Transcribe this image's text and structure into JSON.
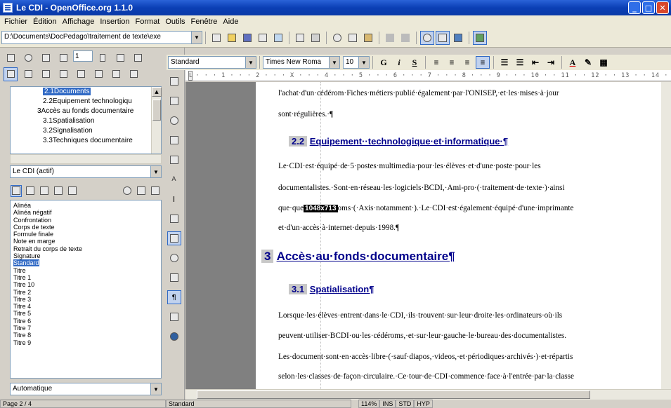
{
  "window": {
    "title": "Le CDI - OpenOffice.org 1.1.0"
  },
  "menu": [
    "Fichier",
    "Édition",
    "Affichage",
    "Insertion",
    "Format",
    "Outils",
    "Fenêtre",
    "Aide"
  ],
  "toolbar": {
    "path": "D:\\Documents\\DocPedago\\traitement de texte\\exe"
  },
  "navigator": {
    "items": [
      {
        "label": "2.1Documents",
        "selected": true,
        "indent": 1
      },
      {
        "label": "2.2Equipement technologiqu",
        "selected": false,
        "indent": 1
      },
      {
        "label": "3Accès au fonds documentaire",
        "selected": false,
        "indent": 0
      },
      {
        "label": "3.1Spatialisation",
        "selected": false,
        "indent": 1
      },
      {
        "label": "3.2Signalisation",
        "selected": false,
        "indent": 1
      },
      {
        "label": "3.3Techniques documentaire",
        "selected": false,
        "indent": 1
      }
    ],
    "page_input": "1",
    "document_combo": "Le CDI (actif)"
  },
  "styles": {
    "items": [
      "Alinéa",
      "Alinéa négatif",
      "Confrontation",
      "Corps de texte",
      "Formule finale",
      "Note en marge",
      "Retrait du corps de texte",
      "Signature",
      "Standard",
      "Titre",
      "Titre 1",
      "Titre 10",
      "Titre 2",
      "Titre 3",
      "Titre 4",
      "Titre 5",
      "Titre 6",
      "Titre 7",
      "Titre 8",
      "Titre 9"
    ],
    "selected": "Standard",
    "filter": "Automatique"
  },
  "format": {
    "style": "Standard",
    "font": "Times New Roma",
    "size": "10"
  },
  "ruler": {
    "marks": "· · · 1 · · · 2 · · · X · · · 4 · · · 5 · · · 6 · · · 7 · · · 8 · · · 9 · · · 10 · · 11 · · 12 · · 13 · · 14 · · 15 · · 16 ·"
  },
  "document": {
    "p1a": "l'achat·d'un·cédérom·Fiches·métiers·publié·également·par·l'ONISEP,·et·les·mises·à·jour",
    "p1b": "sont·régulières.·¶",
    "h22_num": "2.2",
    "h22_text": "Equipement··technologique·et·informatique·¶",
    "p2a": "Le·CDI·est·équipé·de·5·postes·multimedia·pour·les·élèves·et·d'une·poste·pour·les",
    "p2b": "documentalistes.·Sont·en·réseau·les·logiciels·BCDI,·Ami-pro·(·traitement·de·texte·)·ainsi",
    "p2c_pre": "que·que",
    "p2c_tooltip": "1048x713",
    "p2c_post": "oms·(·Axis·notamment·).·Le·CDI·est·également·équipé·d'une·imprimante",
    "p2d": "et·d'un·accès·à·internet·depuis·1998.¶",
    "h3_num": "3",
    "h3_text": "Accès·au·fonds·documentaire¶",
    "h31_num": "3.1",
    "h31_text": "Spatialisation¶",
    "p3a": "Lorsque·les·élèves·entrent·dans·le·CDI,·ils·trouvent·sur·leur·droite·les·ordinateurs·où·ils",
    "p3b": "peuvent·utiliser·BCDI·ou·les·cédéroms,·et·sur·leur·gauche·le·bureau·des·documentalistes.",
    "p3c": "Les·document·sont·en·accès·libre·(·sauf·diapos,·videos,·et·périodiques·archivés·)·et·répartis",
    "p3d": "selon·les·classes·de·façon·circulaire.·Ce·tour·de·CDI·commence·face·à·l'entrée·par·la·classe"
  },
  "status": {
    "page": "Page 2 / 4",
    "style": "Standard",
    "zoom": "114%",
    "ins": "INS",
    "std": "STD",
    "hyp": "HYP"
  }
}
